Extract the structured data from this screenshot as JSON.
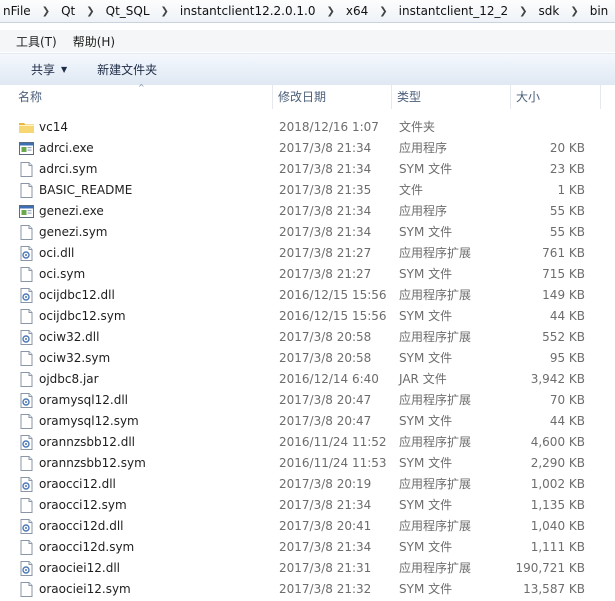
{
  "address": {
    "crumbs": [
      "nFile",
      "Qt",
      "Qt_SQL",
      "instantclient12.2.0.1.0",
      "x64",
      "instantclient_12_2",
      "sdk",
      "bin"
    ],
    "separator": "❯"
  },
  "menu": {
    "tools": "工具(T)",
    "help": "帮助(H)"
  },
  "toolbar": {
    "share": "共享",
    "new_folder": "新建文件夹"
  },
  "columns": {
    "name": "名称",
    "date": "修改日期",
    "type": "类型",
    "size": "大小"
  },
  "files": [
    {
      "name": "vc14",
      "date": "2018/12/16 1:07",
      "type": "文件夹",
      "size": "",
      "icon": "folder-icon"
    },
    {
      "name": "adrci.exe",
      "date": "2017/3/8 21:34",
      "type": "应用程序",
      "size": "20 KB",
      "icon": "exe-icon"
    },
    {
      "name": "adrci.sym",
      "date": "2017/3/8 21:34",
      "type": "SYM 文件",
      "size": "23 KB",
      "icon": "file-icon"
    },
    {
      "name": "BASIC_README",
      "date": "2017/3/8 21:35",
      "type": "文件",
      "size": "1 KB",
      "icon": "file-icon"
    },
    {
      "name": "genezi.exe",
      "date": "2017/3/8 21:34",
      "type": "应用程序",
      "size": "55 KB",
      "icon": "exe-icon"
    },
    {
      "name": "genezi.sym",
      "date": "2017/3/8 21:34",
      "type": "SYM 文件",
      "size": "55 KB",
      "icon": "file-icon"
    },
    {
      "name": "oci.dll",
      "date": "2017/3/8 21:27",
      "type": "应用程序扩展",
      "size": "761 KB",
      "icon": "dll-icon"
    },
    {
      "name": "oci.sym",
      "date": "2017/3/8 21:27",
      "type": "SYM 文件",
      "size": "715 KB",
      "icon": "file-icon"
    },
    {
      "name": "ocijdbc12.dll",
      "date": "2016/12/15 15:56",
      "type": "应用程序扩展",
      "size": "149 KB",
      "icon": "dll-icon"
    },
    {
      "name": "ocijdbc12.sym",
      "date": "2016/12/15 15:56",
      "type": "SYM 文件",
      "size": "44 KB",
      "icon": "file-icon"
    },
    {
      "name": "ociw32.dll",
      "date": "2017/3/8 20:58",
      "type": "应用程序扩展",
      "size": "552 KB",
      "icon": "dll-icon"
    },
    {
      "name": "ociw32.sym",
      "date": "2017/3/8 20:58",
      "type": "SYM 文件",
      "size": "95 KB",
      "icon": "file-icon"
    },
    {
      "name": "ojdbc8.jar",
      "date": "2016/12/14 6:40",
      "type": "JAR 文件",
      "size": "3,942 KB",
      "icon": "file-icon"
    },
    {
      "name": "oramysql12.dll",
      "date": "2017/3/8 20:47",
      "type": "应用程序扩展",
      "size": "70 KB",
      "icon": "dll-icon"
    },
    {
      "name": "oramysql12.sym",
      "date": "2017/3/8 20:47",
      "type": "SYM 文件",
      "size": "44 KB",
      "icon": "file-icon"
    },
    {
      "name": "orannzsbb12.dll",
      "date": "2016/11/24 11:52",
      "type": "应用程序扩展",
      "size": "4,600 KB",
      "icon": "dll-icon"
    },
    {
      "name": "orannzsbb12.sym",
      "date": "2016/11/24 11:53",
      "type": "SYM 文件",
      "size": "2,290 KB",
      "icon": "file-icon"
    },
    {
      "name": "oraocci12.dll",
      "date": "2017/3/8 20:19",
      "type": "应用程序扩展",
      "size": "1,002 KB",
      "icon": "dll-icon"
    },
    {
      "name": "oraocci12.sym",
      "date": "2017/3/8 21:34",
      "type": "SYM 文件",
      "size": "1,135 KB",
      "icon": "file-icon"
    },
    {
      "name": "oraocci12d.dll",
      "date": "2017/3/8 20:41",
      "type": "应用程序扩展",
      "size": "1,040 KB",
      "icon": "dll-icon"
    },
    {
      "name": "oraocci12d.sym",
      "date": "2017/3/8 21:34",
      "type": "SYM 文件",
      "size": "1,111 KB",
      "icon": "file-icon"
    },
    {
      "name": "oraociei12.dll",
      "date": "2017/3/8 21:31",
      "type": "应用程序扩展",
      "size": "190,721 KB",
      "icon": "dll-icon"
    },
    {
      "name": "oraociei12.sym",
      "date": "2017/3/8 21:32",
      "type": "SYM 文件",
      "size": "13,587 KB",
      "icon": "file-icon"
    }
  ]
}
